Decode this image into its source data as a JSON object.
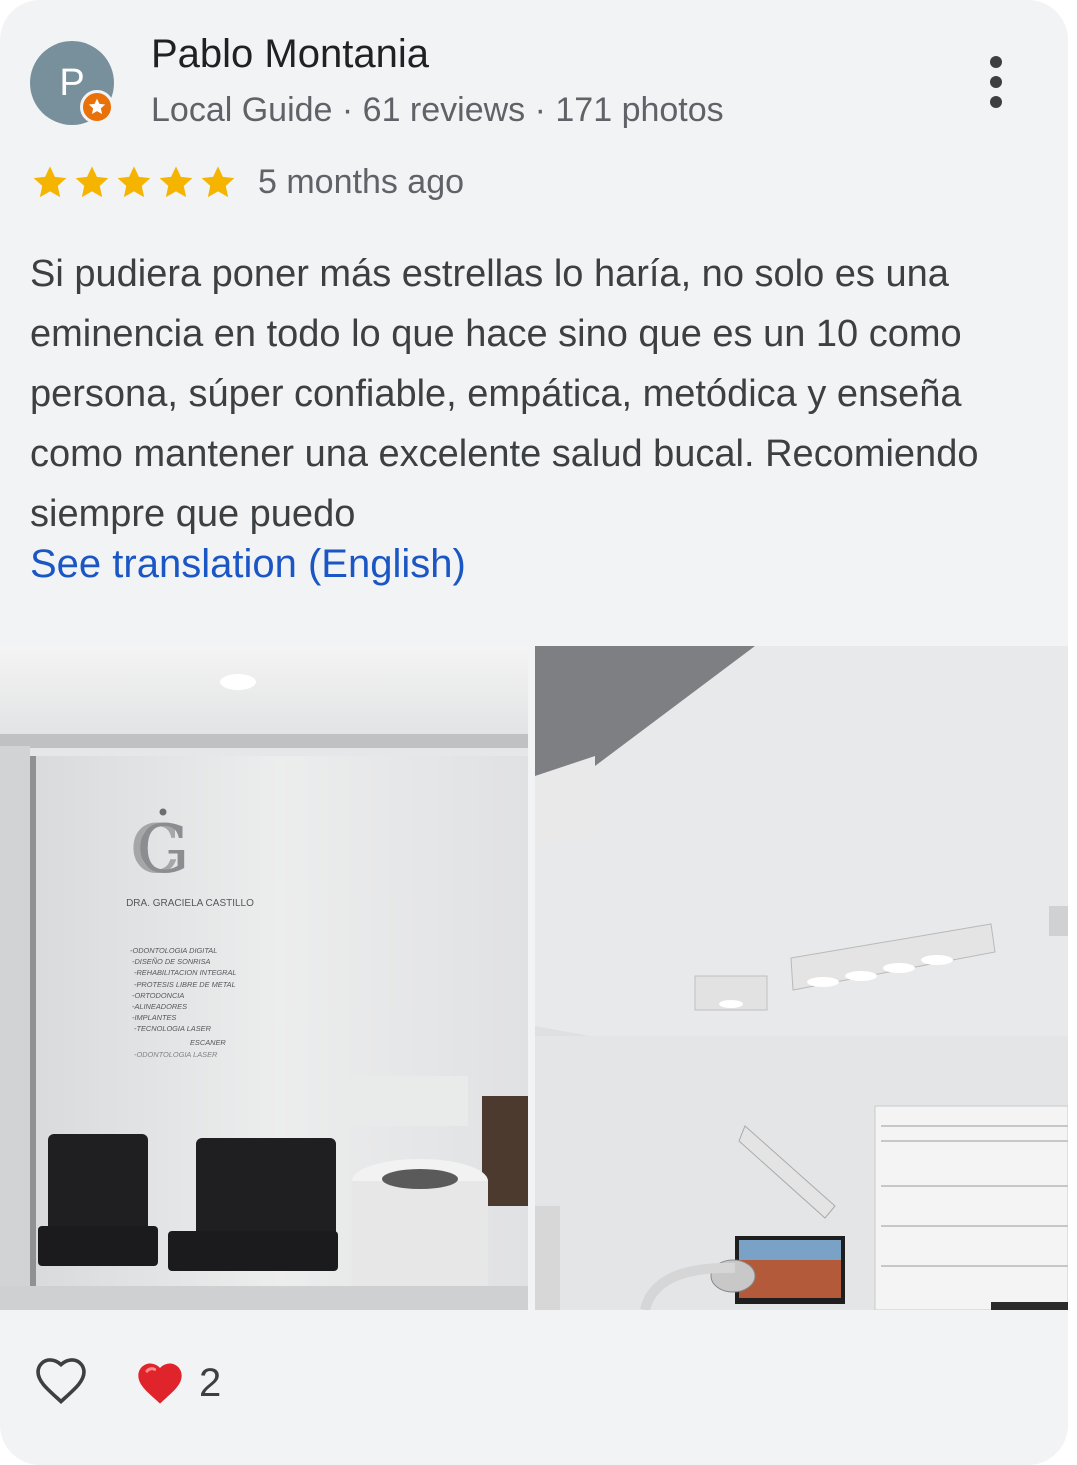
{
  "reviewer": {
    "initial": "P",
    "name": "Pablo Montania",
    "meta": "Local Guide · 61 reviews · 171 photos",
    "avatar_color": "#78909c",
    "badge_color": "#e8710a"
  },
  "rating": {
    "stars": 5,
    "star_color": "#f4b400",
    "date": "5 months ago"
  },
  "review": {
    "text": "Si pudiera poner más estrellas lo haría, no solo es una eminencia en todo lo que hace sino que es un 10 como persona, súper confiable, empática, metódica y enseña como mantener una excelente salud bucal. Recomiendo siempre que puedo",
    "translate_link": "See translation (English)",
    "link_color": "#1a56c4"
  },
  "photos": {
    "photo1": {
      "logo_text": "DRA. GRACIELA CASTILLO",
      "services": [
        "-ODONTOLOGIA DIGITAL",
        "-DISEÑO DE SONRISA",
        "-REHABILITACION INTEGRAL",
        "-PROTESIS LIBRE DE METAL",
        "-ORTODONCIA",
        "-ALINEADORES",
        "-IMPLANTES",
        "-TECNOLOGIA LASER",
        "ESCANER",
        "-ODONTOLOGIA LASER"
      ]
    }
  },
  "footer": {
    "like_icon": "heart-outline-icon",
    "reaction_icon": "red-heart-emoji",
    "reaction_count": "2"
  }
}
